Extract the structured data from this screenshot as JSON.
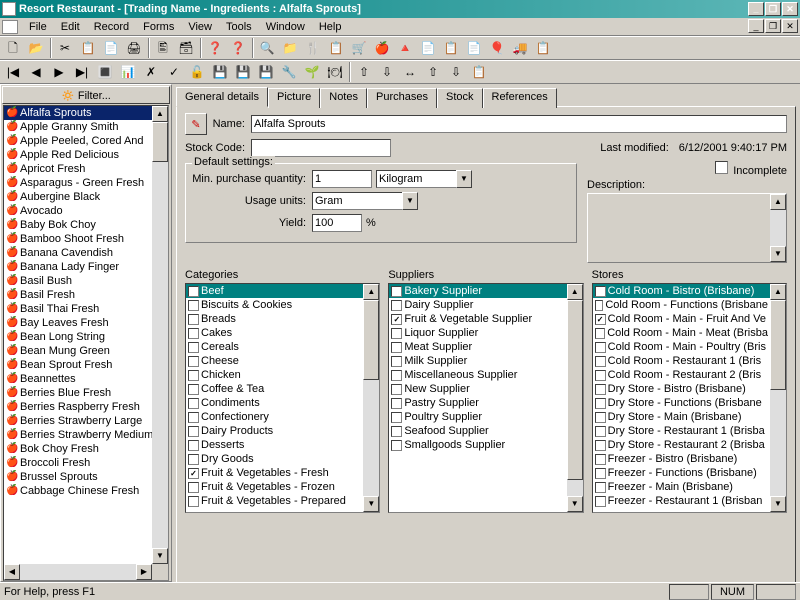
{
  "title": "Resort Restaurant - [Trading Name - Ingredients : Alfalfa Sprouts]",
  "menu": [
    "File",
    "Edit",
    "Record",
    "Forms",
    "View",
    "Tools",
    "Window",
    "Help"
  ],
  "filter_label": "🔅 Filter...",
  "ingredients": [
    "Alfalfa Sprouts",
    "Apple Granny Smith",
    "Apple Peeled, Cored And",
    "Apple Red Delicious",
    "Apricot Fresh",
    "Asparagus - Green Fresh",
    "Aubergine Black",
    "Avocado",
    "Baby Bok Choy",
    "Bamboo Shoot Fresh",
    "Banana Cavendish",
    "Banana Lady Finger",
    "Basil Bush",
    "Basil Fresh",
    "Basil Thai Fresh",
    "Bay Leaves Fresh",
    "Bean Long String",
    "Bean Mung Green",
    "Bean Sprout Fresh",
    "Beannettes",
    "Berries Blue Fresh",
    "Berries Raspberry Fresh",
    "Berries Strawberry Large",
    "Berries Strawberry Medium",
    "Bok Choy Fresh",
    "Broccoli Fresh",
    "Brussel Sprouts",
    "Cabbage Chinese Fresh"
  ],
  "tabs": [
    "General details",
    "Picture",
    "Notes",
    "Purchases",
    "Stock",
    "References"
  ],
  "form": {
    "name_label": "Name:",
    "name": "Alfalfa Sprouts",
    "stock_code_label": "Stock Code:",
    "stock_code": "",
    "last_modified_label": "Last modified:",
    "last_modified": "6/12/2001 9:40:17 PM",
    "incomplete_label": "Incomplete",
    "description_label": "Description:",
    "defaults_legend": "Default settings:",
    "min_purchase_label": "Min. purchase quantity:",
    "min_purchase_qty": "1",
    "min_purchase_unit": "Kilogram",
    "usage_units_label": "Usage units:",
    "usage_units": "Gram",
    "yield_label": "Yield:",
    "yield": "100",
    "yield_pct": "%"
  },
  "categories_label": "Categories",
  "categories": [
    {
      "label": "Beef",
      "checked": false,
      "hi": true
    },
    {
      "label": "Biscuits & Cookies",
      "checked": false
    },
    {
      "label": "Breads",
      "checked": false
    },
    {
      "label": "Cakes",
      "checked": false
    },
    {
      "label": "Cereals",
      "checked": false
    },
    {
      "label": "Cheese",
      "checked": false
    },
    {
      "label": "Chicken",
      "checked": false
    },
    {
      "label": "Coffee & Tea",
      "checked": false
    },
    {
      "label": "Condiments",
      "checked": false
    },
    {
      "label": "Confectionery",
      "checked": false
    },
    {
      "label": "Dairy Products",
      "checked": false
    },
    {
      "label": "Desserts",
      "checked": false
    },
    {
      "label": "Dry Goods",
      "checked": false
    },
    {
      "label": "Fruit & Vegetables - Fresh",
      "checked": true
    },
    {
      "label": "Fruit & Vegetables - Frozen",
      "checked": false
    },
    {
      "label": "Fruit & Vegetables - Prepared",
      "checked": false
    }
  ],
  "suppliers_label": "Suppliers",
  "suppliers": [
    {
      "label": "Bakery Supplier",
      "checked": false,
      "hi": true
    },
    {
      "label": "Dairy Supplier",
      "checked": false
    },
    {
      "label": "Fruit & Vegetable Supplier",
      "checked": true
    },
    {
      "label": "Liquor Supplier",
      "checked": false
    },
    {
      "label": "Meat Supplier",
      "checked": false
    },
    {
      "label": "Milk Supplier",
      "checked": false
    },
    {
      "label": "Miscellaneous Supplier",
      "checked": false
    },
    {
      "label": "New Supplier",
      "checked": false
    },
    {
      "label": "Pastry Supplier",
      "checked": false
    },
    {
      "label": "Poultry Supplier",
      "checked": false
    },
    {
      "label": "Seafood Supplier",
      "checked": false
    },
    {
      "label": "Smallgoods Supplier",
      "checked": false
    }
  ],
  "stores_label": "Stores",
  "stores": [
    {
      "label": "Cold Room - Bistro (Brisbane)",
      "checked": false,
      "hi": true
    },
    {
      "label": "Cold Room - Functions (Brisbane",
      "checked": false
    },
    {
      "label": "Cold Room - Main - Fruit And Ve",
      "checked": true
    },
    {
      "label": "Cold Room - Main - Meat (Brisba",
      "checked": false
    },
    {
      "label": "Cold Room - Main - Poultry (Bris",
      "checked": false
    },
    {
      "label": "Cold Room - Restaurant 1 (Bris",
      "checked": false
    },
    {
      "label": "Cold Room - Restaurant 2 (Bris",
      "checked": false
    },
    {
      "label": "Dry Store - Bistro (Brisbane)",
      "checked": false
    },
    {
      "label": "Dry Store - Functions (Brisbane",
      "checked": false
    },
    {
      "label": "Dry Store - Main (Brisbane)",
      "checked": false
    },
    {
      "label": "Dry Store - Restaurant 1 (Brisba",
      "checked": false
    },
    {
      "label": "Dry Store - Restaurant 2 (Brisba",
      "checked": false
    },
    {
      "label": "Freezer - Bistro (Brisbane)",
      "checked": false
    },
    {
      "label": "Freezer - Functions (Brisbane)",
      "checked": false
    },
    {
      "label": "Freezer - Main (Brisbane)",
      "checked": false
    },
    {
      "label": "Freezer - Restaurant 1 (Brisban",
      "checked": false
    }
  ],
  "status": {
    "help": "For Help, press F1",
    "num": "NUM"
  },
  "toolbar2_icons": [
    "|◀",
    "◀",
    "▶",
    "▶|",
    "🔳",
    "📊",
    "✗",
    "✓",
    "🔓",
    "💾",
    "💾",
    "💾",
    "🔧",
    "🌱",
    "🍽",
    "",
    "⇧",
    "⇩",
    "↔",
    "⇧",
    "⇩",
    "📋"
  ],
  "toolbar1_icons": [
    "🗋",
    "📂",
    "",
    "✂",
    "📋",
    "📄",
    "🖨",
    "",
    "🖺",
    "🗃",
    "",
    "❓",
    "❓",
    "",
    "🔍",
    "📁",
    "🍴",
    "📋",
    "🛒",
    "🍎",
    "🔺",
    "📄",
    "📋",
    "📄",
    "🎈",
    "🚚",
    "📋"
  ]
}
